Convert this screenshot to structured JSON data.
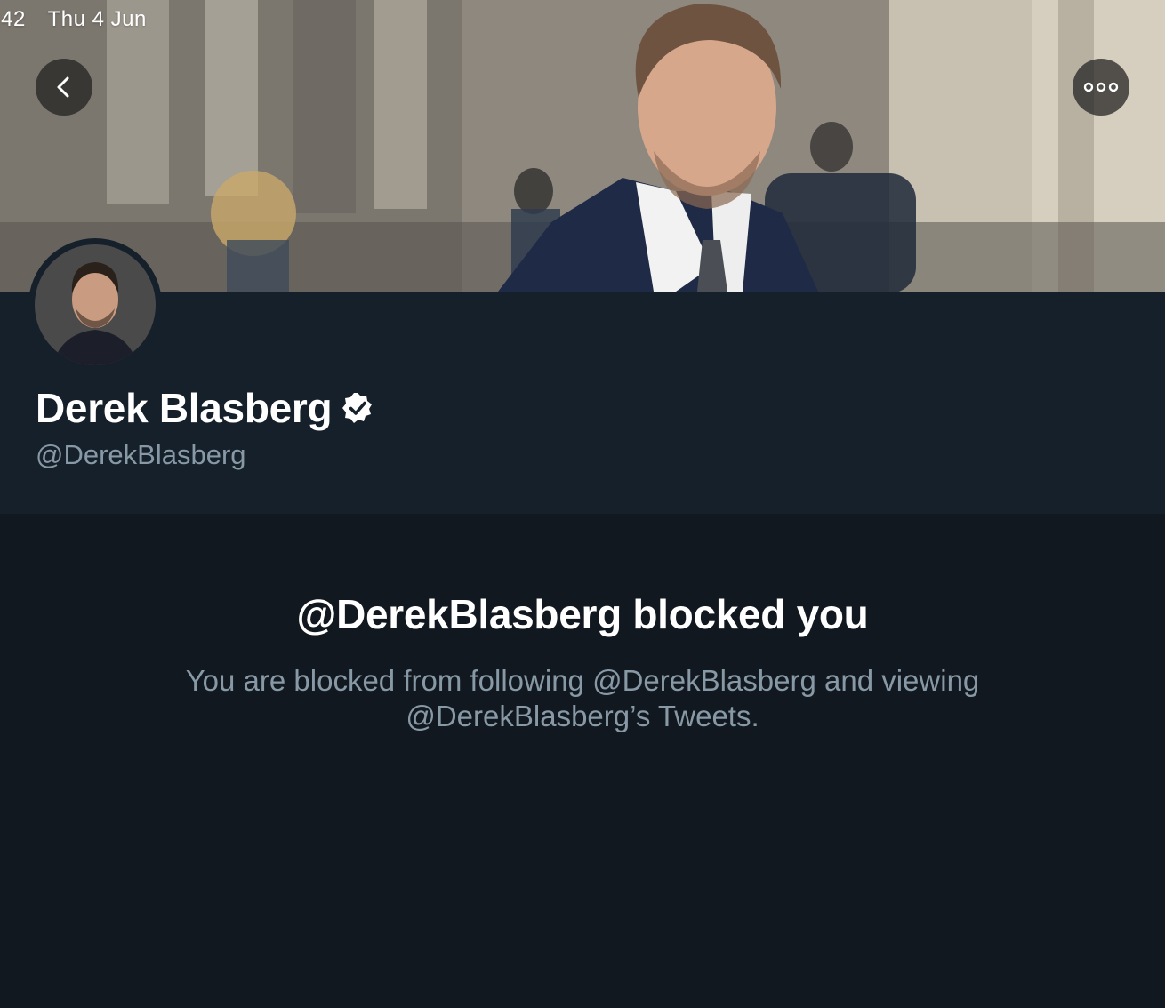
{
  "status_bar": {
    "time": ":42",
    "date": "Thu 4 Jun"
  },
  "header": {
    "back_icon": "chevron-left-icon",
    "more_icon": "more-horizontal-icon"
  },
  "profile": {
    "display_name": "Derek Blasberg",
    "verified": true,
    "verified_icon": "verified-badge-icon",
    "handle": "@DerekBlasberg"
  },
  "blocked": {
    "title": "@DerekBlasberg blocked you",
    "description_line1": "You are blocked from following @DerekBlasberg and viewing",
    "description_line2": "@DerekBlasberg’s Tweets."
  },
  "colors": {
    "profile_bg": "#15202b",
    "content_bg": "#121820",
    "secondary_text": "#8899a6",
    "primary_text": "#ffffff"
  }
}
